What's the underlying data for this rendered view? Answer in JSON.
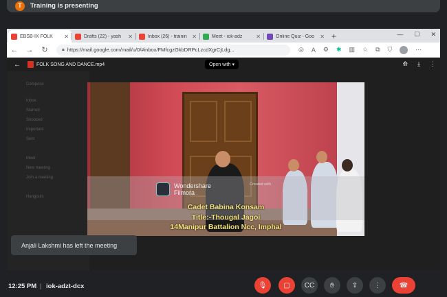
{
  "meet": {
    "presenter_initial": "T",
    "presenter_text": "Training is presenting",
    "toast": "Anjali Lakshmi has left the meeting",
    "time": "12:25 PM",
    "divider": "|",
    "meeting_code": "iok-adzt-dcx"
  },
  "browser": {
    "tabs": [
      {
        "label": "EBSB-IX FOLK",
        "icon_color": "#ea4335"
      },
      {
        "label": "Drafts (22) - yash",
        "icon_color": "#ea4335"
      },
      {
        "label": "Inbox (26) - trainin",
        "icon_color": "#ea4335"
      },
      {
        "label": "Meet - iok-adz",
        "icon_color": "#34a853"
      },
      {
        "label": "Online Quiz - Goo",
        "icon_color": "#7248b9"
      }
    ],
    "url": "https://mail.google.com/mail/u/0/#inbox/FMfcgzGkbDRPcLzcdXgrCjLdg..."
  },
  "viewer": {
    "file_name": "FOLK SONG AND DANCE.mp4",
    "open_with": "Open with ▾"
  },
  "background_list": [
    "Compose",
    "Inbox",
    "Starred",
    "Snoozed",
    "Important",
    "Sent",
    "Meet",
    "New meeting",
    "Join a meeting",
    "Hangouts"
  ],
  "video": {
    "brand_line1": "Wondershare",
    "brand_line2": "Filmora",
    "created_with": "Created with",
    "caption1": "Cadet Babina Konsam",
    "caption2": "Title:-Thougal Jagoi",
    "caption3": "14Manipur Battalion Ncc, Imphal"
  },
  "colors": {
    "end_call": "#ea4335",
    "meet_bg": "#202124"
  }
}
